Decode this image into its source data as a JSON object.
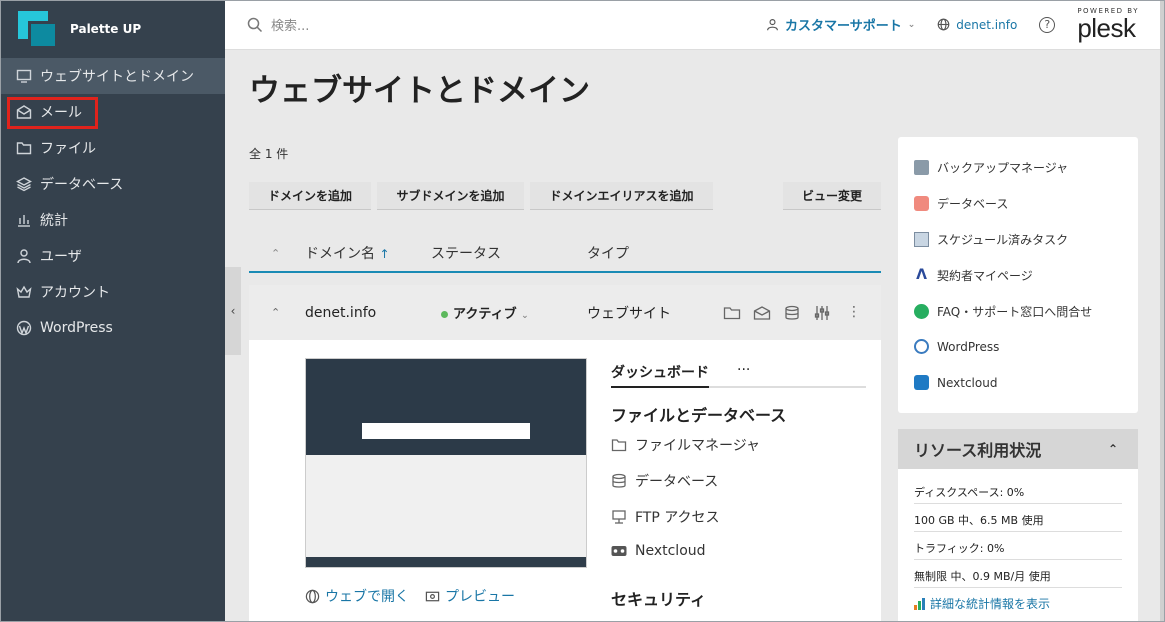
{
  "brand": {
    "name": "Palette UP"
  },
  "sidebar": {
    "items": [
      {
        "label": "ウェブサイトとドメイン",
        "icon": "monitor-icon"
      },
      {
        "label": "メール",
        "icon": "mail-icon"
      },
      {
        "label": "ファイル",
        "icon": "folder-icon"
      },
      {
        "label": "データベース",
        "icon": "layers-icon"
      },
      {
        "label": "統計",
        "icon": "chart-icon"
      },
      {
        "label": "ユーザ",
        "icon": "user-icon"
      },
      {
        "label": "アカウント",
        "icon": "crown-icon"
      },
      {
        "label": "WordPress",
        "icon": "wordpress-icon"
      }
    ]
  },
  "topbar": {
    "search_placeholder": "検索...",
    "support_label": "カスタマーサポート",
    "domain_label": "denet.info",
    "help_label": "?",
    "powered_by": "POWERED BY",
    "plesk": "plesk"
  },
  "page": {
    "title": "ウェブサイトとドメイン"
  },
  "main": {
    "count": "全 1 件",
    "buttons": {
      "add_domain": "ドメインを追加",
      "add_subdomain": "サブドメインを追加",
      "add_alias": "ドメインエイリアスを追加",
      "change_view": "ビュー変更"
    },
    "columns": {
      "domain": "ドメイン名",
      "sort": "↑",
      "status": "ステータス",
      "type": "タイプ"
    },
    "row": {
      "domain": "denet.info",
      "status": "アクティブ",
      "type": "ウェブサイト"
    },
    "detail": {
      "open_web": "ウェブで開く",
      "preview": "プレビュー",
      "tab_dashboard": "ダッシュボード",
      "tab_more": "···",
      "files_title": "ファイルとデータベース",
      "items": [
        "ファイルマネージャ",
        "データベース",
        "FTP アクセス",
        "Nextcloud"
      ],
      "security_title": "セキュリティ"
    }
  },
  "right": {
    "items": [
      "バックアップマネージャ",
      "データベース",
      "スケジュール済みタスク",
      "契約者マイページ",
      "FAQ・サポート窓口へ問合せ",
      "WordPress",
      "Nextcloud"
    ],
    "resource": {
      "title": "リソース利用状況",
      "disk": "ディスクスペース: 0%",
      "disk_detail": "100 GB 中、6.5 MB 使用",
      "traffic": "トラフィック: 0%",
      "traffic_detail": "無制限 中、0.9 MB/月 使用",
      "stats_link": "詳細な統計情報を表示"
    }
  },
  "colors": {
    "sidebar": "#35414d",
    "accent": "#1976a6",
    "highlight": "#e0231c"
  }
}
